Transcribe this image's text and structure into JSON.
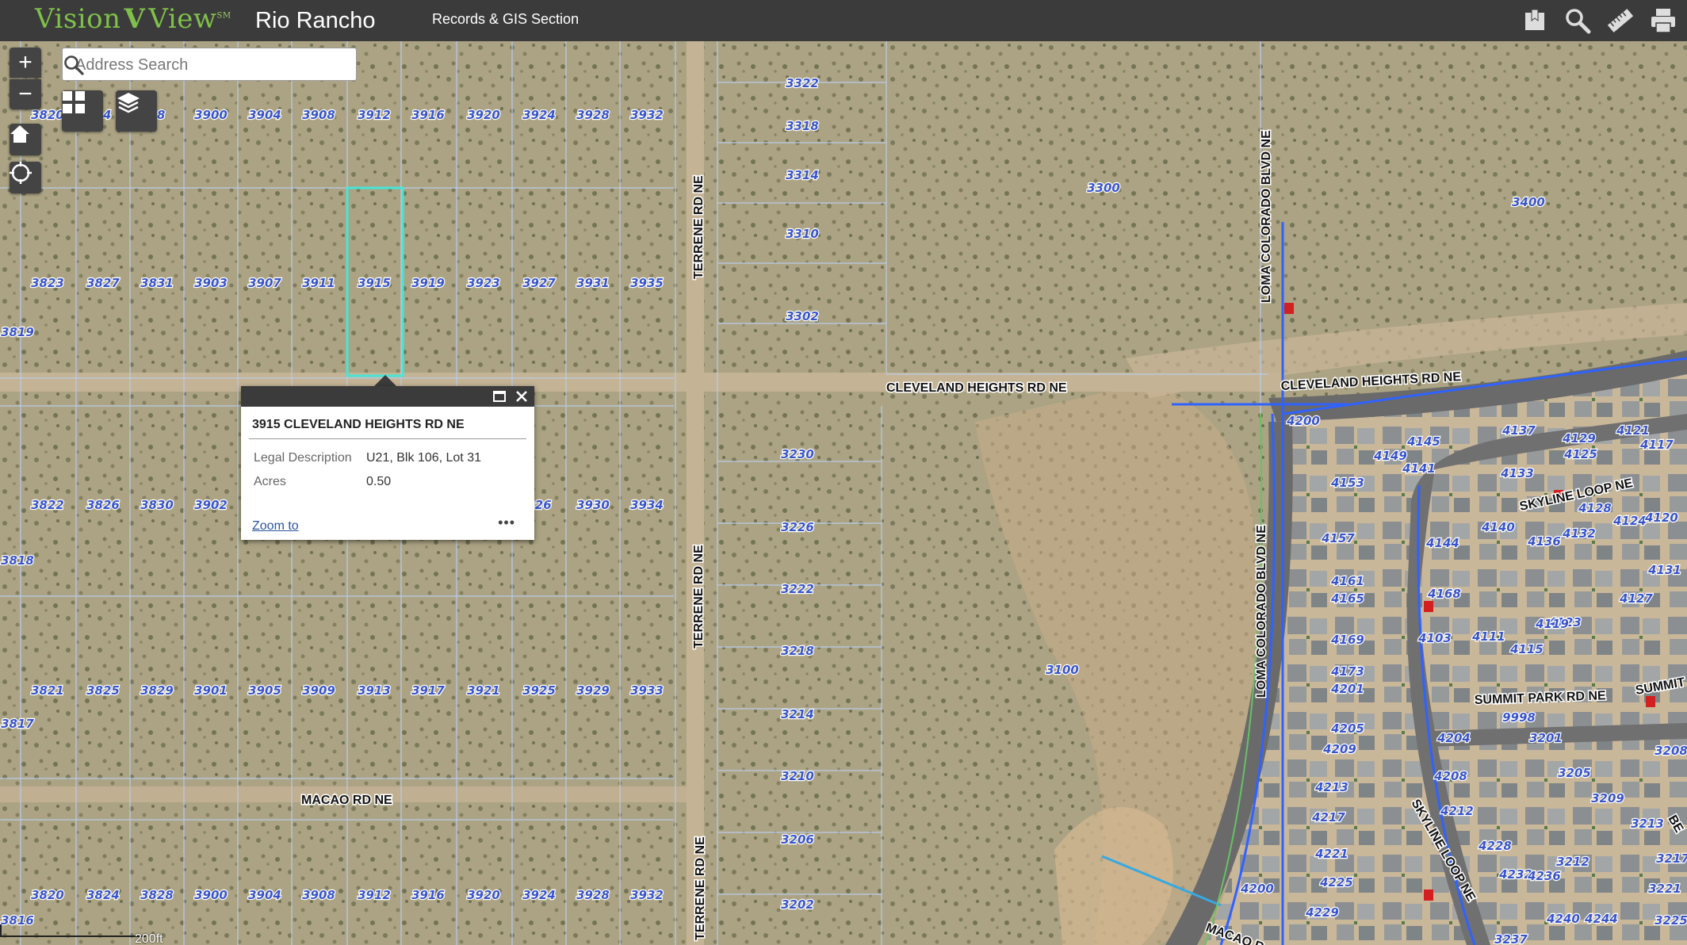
{
  "header": {
    "logo_left": "Vision",
    "logo_right": "View",
    "logo_mark": "SM",
    "city": "Rio Rancho",
    "section": "Records & GIS Section",
    "icons": [
      "bookmark-icon",
      "search-icon",
      "measure-icon",
      "print-icon"
    ]
  },
  "search": {
    "placeholder": "Address Search"
  },
  "map_controls": {
    "zoom_in": "+",
    "zoom_out": "−"
  },
  "popup": {
    "title": "3915 CLEVELAND HEIGHTS RD NE",
    "fields": [
      {
        "label": "Legal Description",
        "value": "U21, Blk 106, Lot 31"
      },
      {
        "label": "Acres",
        "value": "0.50"
      }
    ],
    "zoom_link": "Zoom to",
    "more": "•••"
  },
  "scale_label": "200ft",
  "streets": {
    "cleveland_west": "CLEVELAND HEIGHTS RD NE",
    "cleveland_east": "CLEVELAND HEIGHTS RD NE",
    "macao": "MACAO RD NE",
    "macao_east": "MACAO R",
    "terrene_1": "TERRENE RD NE",
    "terrene_2": "TERRENE RD NE",
    "terrene_3": "TERRENE RD NE",
    "loma_1": "LOMA COLORADO BLVD NE",
    "loma_2": "LOMA COLORADO BLVD NE",
    "skyline_1": "SKYLINE LOOP NE",
    "skyline_2": "SKYLINE LOOP NE",
    "summit": "SUMMIT PARK RD NE",
    "summit_edge": "SUMMIT",
    "edge_be": "BE"
  },
  "parcels": {
    "row1": [
      "3820",
      "24",
      "28",
      "3900",
      "3904",
      "3908",
      "3912",
      "3916",
      "3920",
      "3924",
      "3928",
      "3932"
    ],
    "row2": [
      "3823",
      "3827",
      "3831",
      "3903",
      "3907",
      "3911",
      "3915",
      "3919",
      "3923",
      "3927",
      "3931",
      "3935"
    ],
    "row3": [
      "3822",
      "3826",
      "3830",
      "3902",
      "926",
      "3930",
      "3934"
    ],
    "row4": [
      "3821",
      "3825",
      "3829",
      "3901",
      "3905",
      "3909",
      "3913",
      "3917",
      "3921",
      "3925",
      "3929",
      "3933"
    ],
    "row5": [
      "3820",
      "3824",
      "3828",
      "3900",
      "3904",
      "3908",
      "3912",
      "3916",
      "3920",
      "3924",
      "3928",
      "3932"
    ],
    "left_edge": [
      "3819",
      "3818",
      "3817",
      "3816"
    ],
    "terrene_east_top": [
      "3322",
      "3318",
      "3314",
      "3310",
      "3302"
    ],
    "terrene_east_bottom": [
      "3230",
      "3226",
      "3222",
      "3218",
      "3214",
      "3210",
      "3206",
      "3202"
    ],
    "open": [
      "3300",
      "3400",
      "3100"
    ],
    "sub_a": [
      "4200",
      "4153",
      "4157",
      "4161",
      "4165",
      "4169",
      "4173",
      "4201",
      "4205",
      "4209",
      "4213",
      "4217",
      "4221",
      "4225",
      "4229",
      "4200"
    ],
    "sub_b": [
      "4145",
      "4149",
      "4141",
      "4137",
      "4133",
      "4129",
      "4125",
      "4121",
      "4117",
      "4128",
      "4124",
      "4120",
      "4144",
      "4140",
      "4136",
      "4132",
      "4131",
      "4127",
      "4123",
      "4168",
      "4103",
      "4111",
      "4119",
      "4115"
    ],
    "sub_c": [
      "9998",
      "3201",
      "3205",
      "3209",
      "3213",
      "3217",
      "3221",
      "3225",
      "3208",
      "3212",
      "4204",
      "4208",
      "4212",
      "4228",
      "4232",
      "4236",
      "4240",
      "4244",
      "3237"
    ]
  }
}
